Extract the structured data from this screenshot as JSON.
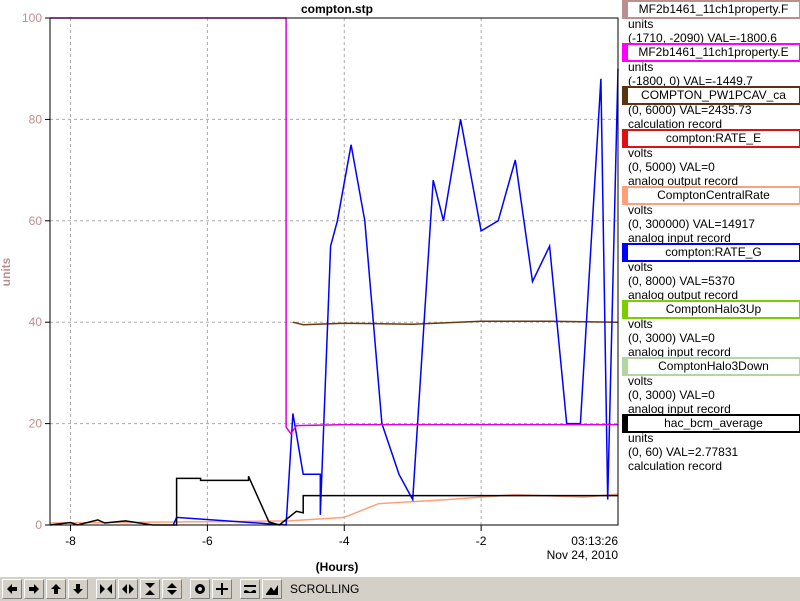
{
  "chart_data": {
    "type": "line",
    "title": "compton.stp",
    "xlabel": "(Hours)",
    "ylabel": "units",
    "xlim": [
      -8.3,
      0
    ],
    "ylim": [
      0,
      100
    ],
    "x_ticks": [
      "-8",
      "-6",
      "-4",
      "-2"
    ],
    "x_tick_values": [
      -8,
      -6,
      -4,
      -2
    ],
    "y_ticks": [
      "0",
      "20",
      "40",
      "60",
      "80",
      "100"
    ],
    "y_tick_values": [
      0,
      20,
      40,
      60,
      80,
      100
    ],
    "grid": true,
    "timestamp_time": "03:13:26",
    "timestamp_date": "Nov 24, 2010",
    "series": [
      {
        "name": "MF2b1461_11ch1property.E",
        "color": "#dd00dd",
        "x": [
          -8.3,
          -4.85,
          -4.85,
          -4.78,
          -4.7,
          -4.0,
          -3.0,
          -2.0,
          -1.0,
          0.0
        ],
        "y": [
          100,
          100,
          19.3,
          18.0,
          19.6,
          19.8,
          19.8,
          19.8,
          19.8,
          19.8
        ]
      },
      {
        "name": "hac_bcm_average",
        "color": "#000000",
        "x": [
          -8.3,
          -8.0,
          -7.9,
          -7.6,
          -7.5,
          -7.2,
          -6.8,
          -6.45,
          -6.45,
          -6.1,
          -6.1,
          -5.4,
          -5.4,
          -5.1,
          -4.95,
          -4.7,
          -4.6,
          -4.6,
          -4.0,
          -3.0,
          -2.0,
          -1.0,
          0.0
        ],
        "y": [
          0,
          0.5,
          0,
          1,
          0.4,
          0.8,
          0,
          0,
          9.2,
          9.2,
          8.8,
          8.8,
          9.6,
          0.6,
          0,
          2.7,
          2.4,
          5.8,
          5.8,
          5.8,
          5.8,
          5.8,
          5.8
        ]
      },
      {
        "name": "COMPTON_PW1PCAV_ca",
        "color": "#6b3a0a",
        "x": [
          -4.75,
          -4.6,
          -4.0,
          -3.0,
          -2.0,
          -1.0,
          0.0
        ],
        "y": [
          40,
          39.5,
          39.8,
          39.6,
          40.2,
          40.2,
          40
        ]
      },
      {
        "name": "ComptonCentralRate",
        "color": "#ffa07a",
        "x": [
          -8.3,
          -4.8,
          -4.0,
          -3.5,
          -2.5,
          -1.5,
          -0.5,
          0.0
        ],
        "y": [
          0.4,
          0.8,
          1.5,
          4.2,
          5.0,
          6.0,
          5.5,
          6.1
        ]
      },
      {
        "name": "compton:RATE_G",
        "color": "#0000ff",
        "x": [
          -6.5,
          -6.45,
          -4.85,
          -4.75,
          -4.6,
          -4.35,
          -4.35,
          -4.2,
          -4.1,
          -3.9,
          -3.7,
          -3.45,
          -3.2,
          -3.0,
          -2.7,
          -2.55,
          -2.3,
          -2.0,
          -1.75,
          -1.5,
          -1.25,
          -1.0,
          -0.75,
          -0.55,
          -0.25,
          -0.15,
          0.0
        ],
        "y": [
          0,
          1.5,
          0,
          22,
          10,
          10,
          2,
          55,
          60,
          75,
          60,
          20,
          10,
          5,
          68,
          60,
          80,
          58,
          60,
          72,
          48,
          55,
          20,
          20,
          88,
          5,
          90
        ]
      }
    ]
  },
  "legend": [
    {
      "title": "MF2b1461_11ch1property.F",
      "color": "#bc8f8f",
      "lines": [
        "units",
        "(-1710, -2090) VAL=-1800.6"
      ]
    },
    {
      "title": "MF2b1461_11ch1property.E",
      "color": "#ff00ff",
      "lines": [
        "units",
        "(-1800, 0) VAL=-1449.7"
      ]
    },
    {
      "title": "COMPTON_PW1PCAV_ca",
      "color": "#5c3311",
      "lines": [
        "(0, 6000) VAL=2435.73",
        "calculation record"
      ]
    },
    {
      "title": "compton:RATE_E",
      "color": "#dd1111",
      "lines": [
        "volts",
        "(0, 5000) VAL=0",
        "analog output record"
      ]
    },
    {
      "title": "ComptonCentralRate",
      "color": "#ffa07a",
      "lines": [
        "volts",
        "(0, 300000) VAL=14917",
        "analog input record"
      ]
    },
    {
      "title": "compton:RATE_G",
      "color": "#0000ff",
      "lines": [
        "volts",
        "(0, 8000) VAL=5370",
        "analog output record"
      ]
    },
    {
      "title": "ComptonHalo3Up",
      "color": "#7ccd00",
      "lines": [
        "volts",
        "(0, 3000) VAL=0",
        "analog input record"
      ]
    },
    {
      "title": "ComptonHalo3Down",
      "color": "#b4d4a0",
      "lines": [
        "volts",
        "(0, 3000) VAL=0",
        "analog input record"
      ]
    },
    {
      "title": "hac_bcm_average",
      "color": "#000000",
      "lines": [
        "units",
        "(0, 60) VAL=2.77831",
        "calculation record"
      ]
    }
  ],
  "toolbar": {
    "buttons": [
      "arrow-left-icon",
      "arrow-right-icon",
      "arrow-up-icon",
      "arrow-down-icon",
      "zoom-in-horizontal-icon",
      "zoom-out-horizontal-icon",
      "zoom-in-vertical-icon",
      "zoom-out-vertical-icon",
      "record-icon",
      "crosshair-icon",
      "autoscale-icon",
      "export-icon"
    ],
    "status": "SCROLLING"
  }
}
